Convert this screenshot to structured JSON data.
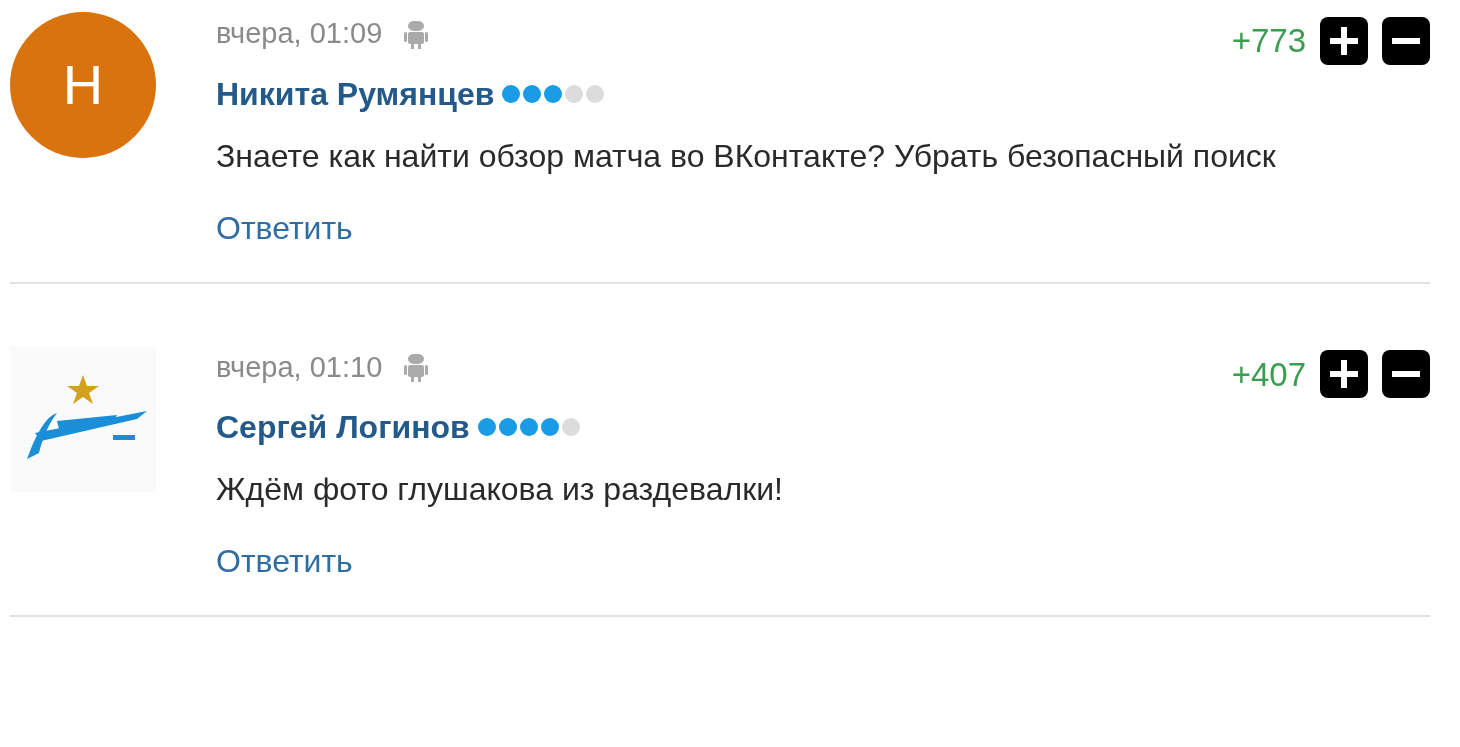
{
  "comments": [
    {
      "avatar": {
        "kind": "letter",
        "letter": "Н"
      },
      "time": "вчера, 01:09",
      "author": "Никита Румянцев",
      "stars": 3,
      "score": "+773",
      "text": "Знаете как найти обзор матча во ВКонтакте? Убрать безопасный поиск",
      "reply": "Ответить"
    },
    {
      "avatar": {
        "kind": "logo"
      },
      "time": "вчера, 01:10",
      "author": "Сергей Логинов",
      "stars": 4,
      "score": "+407",
      "text": "Ждём фото глушакова из раздевалки!",
      "reply": "Ответить"
    }
  ]
}
